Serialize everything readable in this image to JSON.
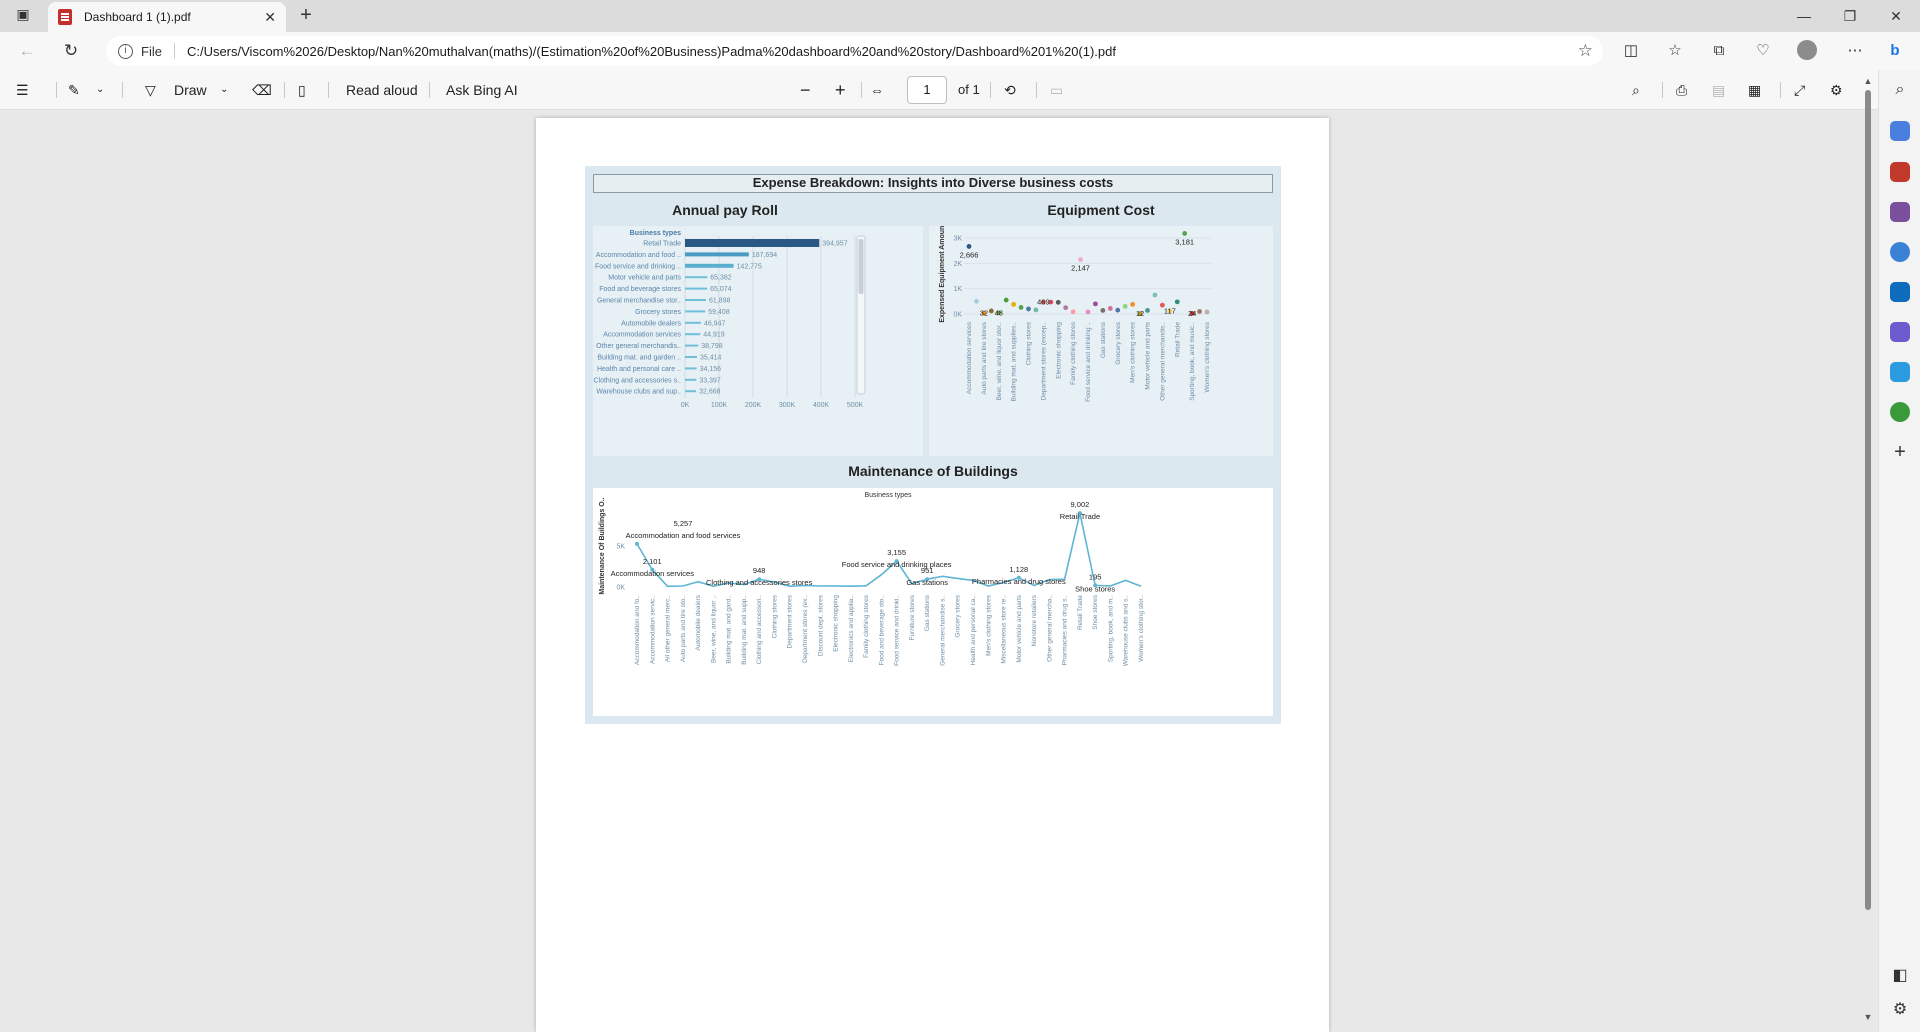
{
  "browser": {
    "tab_title": "Dashboard 1 (1).pdf",
    "address": {
      "scheme_label": "File",
      "url": "C:/Users/Viscom%2026/Desktop/Nan%20muthalvan(maths)/(Estimation%20of%20Business)Padma%20dashboard%20and%20story/Dashboard%201%20(1).pdf"
    }
  },
  "pdf_toolbar": {
    "draw_label": "Draw",
    "read_aloud_label": "Read aloud",
    "ask_bing_label": "Ask Bing AI",
    "page_current": "1",
    "page_total_label": "of 1"
  },
  "dashboard": {
    "title": "Expense Breakdown: Insights into Diverse business costs",
    "payroll": {
      "section_title": "Annual pay Roll",
      "chart_data": {
        "type": "bar",
        "orientation": "horizontal",
        "title": "Annual pay Roll",
        "ylabel": "Business types",
        "categories": [
          "Retail Trade",
          "Accommodation and food ..",
          "Food service and drinking ..",
          "Motor vehicle and parts",
          "Food and beverage stores",
          "General merchandise stor..",
          "Grocery stores",
          "Automobile dealers",
          "Accommodation services",
          "Other general merchandis..",
          "Building mat. and garden ..",
          "Health and personal care ..",
          "Clothing and accessories s..",
          "Warehouse clubs and sup.."
        ],
        "values": [
          394957,
          187694,
          142775,
          65382,
          65074,
          61898,
          59408,
          46947,
          44919,
          38798,
          35414,
          34156,
          33397,
          32668
        ],
        "value_labels": [
          "394,957",
          "187,694",
          "142,775",
          "65,382",
          "65,074",
          "61,898",
          "59,408",
          "46,947",
          "44,919",
          "38,798",
          "35,414",
          "34,156",
          "33,397",
          "32,668"
        ],
        "xlim": [
          0,
          500000
        ],
        "xticks": [
          0,
          100000,
          200000,
          300000,
          400000,
          500000
        ],
        "xtick_labels": [
          "0K",
          "100K",
          "200K",
          "300K",
          "400K",
          "500K"
        ],
        "colors": [
          "#2a5783",
          "#4a9bc4",
          "#5aaed0",
          "#6fbfd8",
          "#6fbfd8",
          "#6fbfd8",
          "#6fbfd8",
          "#6fbfd8",
          "#6fbfd8",
          "#6fbfd8",
          "#6fbfd8",
          "#6fbfd8",
          "#6fbfd8",
          "#6fbfd8"
        ]
      }
    },
    "equipment": {
      "section_title": "Equipment Cost",
      "chart_data": {
        "type": "scatter",
        "title": "Equipment Cost",
        "ylabel": "Expensed Equipment Amount",
        "ylim": [
          0,
          3000
        ],
        "yticks": [
          0,
          1000,
          2000,
          3000
        ],
        "ytick_labels": [
          "0K",
          "1K",
          "2K",
          "3K"
        ],
        "categories": [
          "Accommodation services",
          "Auto parts and tire stores",
          "Beer, wine, and liquor stor..",
          "Building mat. and supplies..",
          "Clothing stores",
          "Department stores (excep..",
          "Electronic shopping",
          "Family clothing stores",
          "Food service and drinking ..",
          "Gas stations",
          "Grocery stores",
          "Men's clothing stores",
          "Motor vehicle and parts",
          "Other general merchandis..",
          "Retail Trade",
          "Sporting, book, and music..",
          "Women's clothing stores"
        ],
        "points": [
          {
            "x": 0,
            "y": 2666,
            "color": "#2a5783"
          },
          {
            "x": 0.5,
            "y": 500,
            "color": "#a6cee3"
          },
          {
            "x": 1,
            "y": 32,
            "color": "#f28e2b"
          },
          {
            "x": 1.5,
            "y": 120,
            "color": "#8c6d31"
          },
          {
            "x": 2,
            "y": 48,
            "color": "#76b041"
          },
          {
            "x": 2.5,
            "y": 550,
            "color": "#4e9a3a"
          },
          {
            "x": 3,
            "y": 380,
            "color": "#e1b000"
          },
          {
            "x": 3.5,
            "y": 260,
            "color": "#59a14f"
          },
          {
            "x": 4,
            "y": 200,
            "color": "#4e79a7"
          },
          {
            "x": 4.5,
            "y": 160,
            "color": "#76b7b2"
          },
          {
            "x": 5,
            "y": 469,
            "color": "#e15759"
          },
          {
            "x": 5.5,
            "y": 470,
            "color": "#d4485a"
          },
          {
            "x": 6,
            "y": 460,
            "color": "#5a5a5a"
          },
          {
            "x": 6.5,
            "y": 250,
            "color": "#b07aa1"
          },
          {
            "x": 7,
            "y": 90,
            "color": "#ff9da7"
          },
          {
            "x": 7.5,
            "y": 2147,
            "color": "#f1a7c8"
          },
          {
            "x": 8,
            "y": 80,
            "color": "#e88bbf"
          },
          {
            "x": 8.5,
            "y": 400,
            "color": "#9c4f96"
          },
          {
            "x": 9,
            "y": 140,
            "color": "#79706e"
          },
          {
            "x": 9.5,
            "y": 220,
            "color": "#d37295"
          },
          {
            "x": 10,
            "y": 150,
            "color": "#4e79a7"
          },
          {
            "x": 10.5,
            "y": 300,
            "color": "#8cd17d"
          },
          {
            "x": 11,
            "y": 380,
            "color": "#f28e2b"
          },
          {
            "x": 11.5,
            "y": 12,
            "color": "#b6992d"
          },
          {
            "x": 12,
            "y": 140,
            "color": "#499894"
          },
          {
            "x": 12.5,
            "y": 750,
            "color": "#86bcb6"
          },
          {
            "x": 13,
            "y": 350,
            "color": "#e15759"
          },
          {
            "x": 13.5,
            "y": 117,
            "color": "#f1ce63"
          },
          {
            "x": 14,
            "y": 480,
            "color": "#2f8b7f"
          },
          {
            "x": 14.5,
            "y": 3181,
            "color": "#59a14f"
          },
          {
            "x": 15,
            "y": 24,
            "color": "#c0392b"
          },
          {
            "x": 15.5,
            "y": 100,
            "color": "#9d7660"
          },
          {
            "x": 16,
            "y": 80,
            "color": "#bab0ac"
          }
        ],
        "annotations": [
          {
            "x": 0,
            "y": 2666,
            "label": "2,666"
          },
          {
            "x": 1,
            "y": 32,
            "label": "32"
          },
          {
            "x": 2,
            "y": 48,
            "label": "48"
          },
          {
            "x": 5,
            "y": 469,
            "label": "469"
          },
          {
            "x": 7.5,
            "y": 2147,
            "label": "2,147"
          },
          {
            "x": 11.5,
            "y": 12,
            "label": "12"
          },
          {
            "x": 13.5,
            "y": 117,
            "label": "117"
          },
          {
            "x": 14.5,
            "y": 3181,
            "label": "3,181"
          },
          {
            "x": 15,
            "y": 24,
            "label": "24"
          }
        ]
      }
    },
    "maintenance": {
      "section_title": "Maintenance of Buildings",
      "chart_data": {
        "type": "line",
        "title": "Maintenance of Buildings",
        "legend_title": "Business types",
        "ylabel": "Maintenance Of Buildings O..",
        "ylim": [
          0,
          10000
        ],
        "yticks": [
          0,
          5000
        ],
        "ytick_labels": [
          "0K",
          "5K"
        ],
        "categories": [
          "Accommodation and fo..",
          "Accommodation servic..",
          "All other general merc..",
          "Auto parts and tire sto..",
          "Automobile dealers",
          "Beer, wine, and liquor ..",
          "Building mat. and gard..",
          "Building mat. and supp..",
          "Clothing and accessori..",
          "Clothing stores",
          "Department stores",
          "Department stores (ex..",
          "Discount dept. stores",
          "Electronic shopping",
          "Electronics and applia..",
          "Family clothing stores",
          "Food and beverage sto..",
          "Food service and drinki..",
          "Furniture stores",
          "Gas stations",
          "General merchandise s..",
          "Grocery stores",
          "Health and personal ca..",
          "Men's clothing stores",
          "Miscellaneous store re..",
          "Motor vehicle and parts",
          "Nonstore retailers",
          "Other general mercha..",
          "Pharmacies and drug s..",
          "Retail Trade",
          "Shoe stores",
          "Sporting, book, and m..",
          "Warehouse clubs and s..",
          "Women's clothing stor.."
        ],
        "values": [
          5257,
          2101,
          80,
          120,
          650,
          80,
          500,
          300,
          948,
          600,
          100,
          180,
          120,
          140,
          100,
          150,
          1500,
          3155,
          400,
          951,
          1300,
          1050,
          800,
          120,
          550,
          1128,
          180,
          900,
          950,
          9002,
          195,
          140,
          800,
          100
        ],
        "annotations": [
          {
            "index": 0,
            "value": "5,257",
            "label": "Accommodation and food services"
          },
          {
            "index": 1,
            "value": "2,101",
            "label": "Accommodation services"
          },
          {
            "index": 8,
            "value": "948",
            "label": "Clothing and accessories stores"
          },
          {
            "index": 17,
            "value": "3,155",
            "label": "Food service and drinking places"
          },
          {
            "index": 19,
            "value": "951",
            "label": "Gas stations"
          },
          {
            "index": 25,
            "value": "1,128",
            "label": "Pharmacies and drug stores"
          },
          {
            "index": 29,
            "value": "9,002",
            "label": "Retail Trade"
          },
          {
            "index": 30,
            "value": "195",
            "label": "Shoe stores"
          }
        ],
        "line_color": "#5fb5d3"
      }
    }
  }
}
